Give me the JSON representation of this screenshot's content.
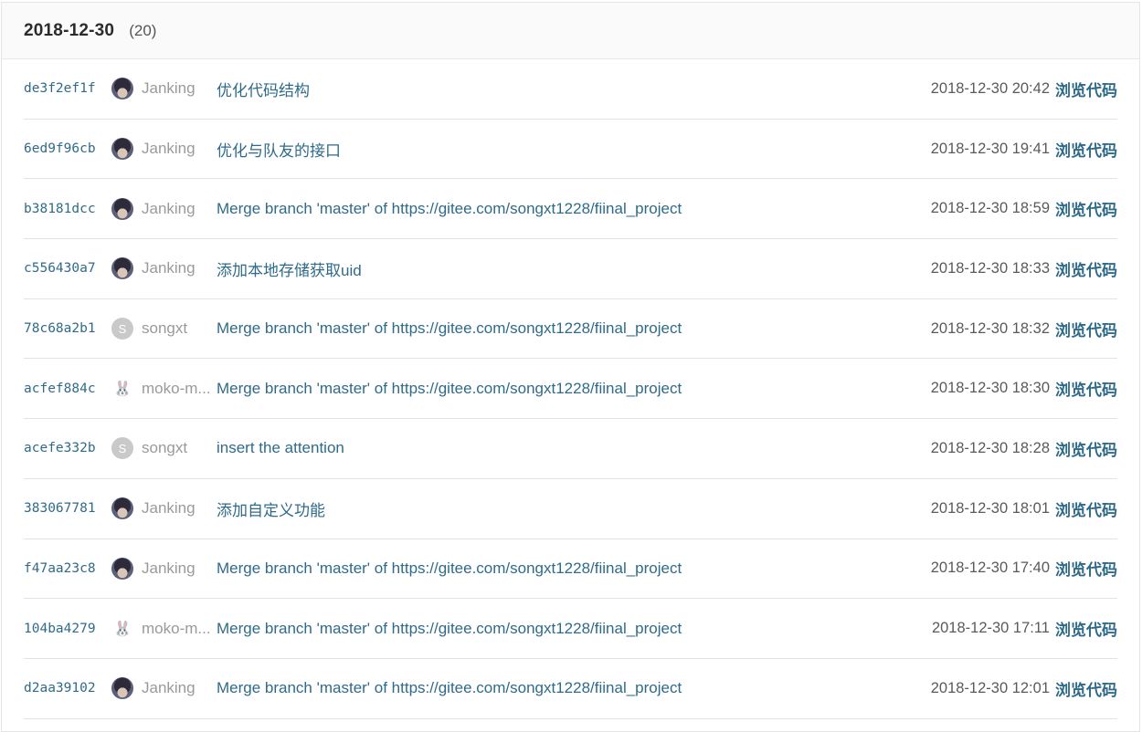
{
  "group": {
    "date": "2018-12-30",
    "count": "(20)"
  },
  "browse_label": "浏览代码",
  "commits": [
    {
      "sha": "de3f2ef1f",
      "avatar": "photo",
      "author": "Janking",
      "message": "优化代码结构",
      "time": "2018-12-30 20:42"
    },
    {
      "sha": "6ed9f96cb",
      "avatar": "photo",
      "author": "Janking",
      "message": "优化与队友的接口",
      "time": "2018-12-30 19:41"
    },
    {
      "sha": "b38181dcc",
      "avatar": "photo",
      "author": "Janking",
      "message": "Merge branch 'master' of https://gitee.com/songxt1228/fiinal_project",
      "time": "2018-12-30 18:59"
    },
    {
      "sha": "c556430a7",
      "avatar": "photo",
      "author": "Janking",
      "message": "添加本地存储获取uid",
      "time": "2018-12-30 18:33"
    },
    {
      "sha": "78c68a2b1",
      "avatar": "letter",
      "avatar_letter": "S",
      "author": "songxt",
      "message": "Merge branch 'master' of https://gitee.com/songxt1228/fiinal_project",
      "time": "2018-12-30 18:32"
    },
    {
      "sha": "acfef884c",
      "avatar": "rabbit",
      "author": "moko-m...",
      "message": "Merge branch 'master' of https://gitee.com/songxt1228/fiinal_project",
      "time": "2018-12-30 18:30"
    },
    {
      "sha": "acefe332b",
      "avatar": "letter",
      "avatar_letter": "S",
      "author": "songxt",
      "message": "insert the attention",
      "time": "2018-12-30 18:28"
    },
    {
      "sha": "383067781",
      "avatar": "photo",
      "author": "Janking",
      "message": "添加自定义功能",
      "time": "2018-12-30 18:01"
    },
    {
      "sha": "f47aa23c8",
      "avatar": "photo",
      "author": "Janking",
      "message": "Merge branch 'master' of https://gitee.com/songxt1228/fiinal_project",
      "time": "2018-12-30 17:40"
    },
    {
      "sha": "104ba4279",
      "avatar": "rabbit",
      "author": "moko-m...",
      "message": "Merge branch 'master' of https://gitee.com/songxt1228/fiinal_project",
      "time": "2018-12-30 17:11"
    },
    {
      "sha": "d2aa39102",
      "avatar": "photo",
      "author": "Janking",
      "message": "Merge branch 'master' of https://gitee.com/songxt1228/fiinal_project",
      "time": "2018-12-30 12:01"
    }
  ]
}
